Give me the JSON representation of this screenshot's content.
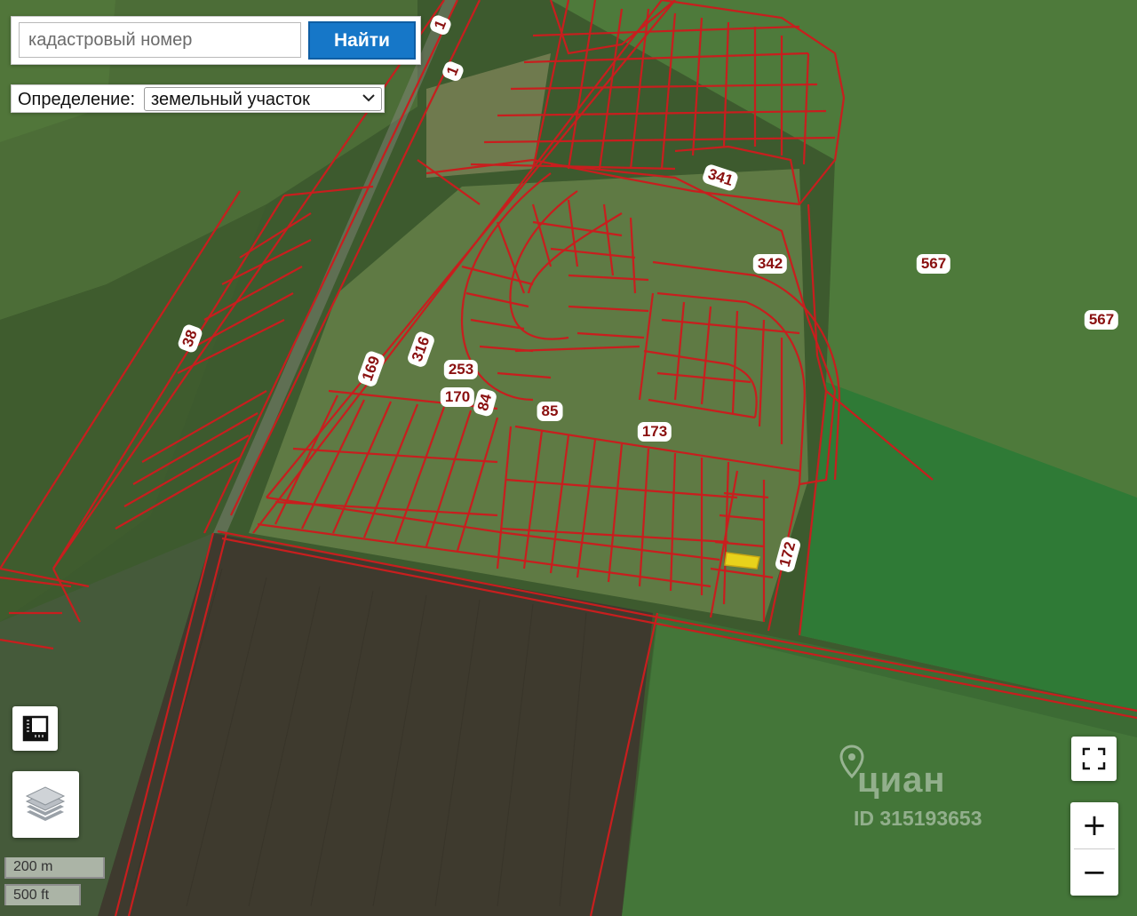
{
  "search": {
    "placeholder": "кадастровый номер",
    "button_label": "Найти"
  },
  "definition": {
    "label": "Определение:",
    "selected": "земельный участок"
  },
  "parcel_labels": [
    "1",
    "1",
    "341",
    "342",
    "567",
    "567",
    "38",
    "169",
    "316",
    "253",
    "170",
    "84",
    "85",
    "173",
    "172"
  ],
  "scale": {
    "metric": "200 m",
    "imperial": "500 ft"
  },
  "watermark": {
    "brand": "циан",
    "id": "ID 315193653"
  },
  "zoom": {
    "in": "+",
    "out": "−"
  },
  "icons": [
    "ruler-icon",
    "layers-icon",
    "fullscreen-icon",
    "location-pin-icon",
    "chevron-down-icon"
  ],
  "colors": {
    "boundary": "#c81e1e",
    "selected_parcel": "#e8d21b",
    "button": "#1677c8"
  }
}
